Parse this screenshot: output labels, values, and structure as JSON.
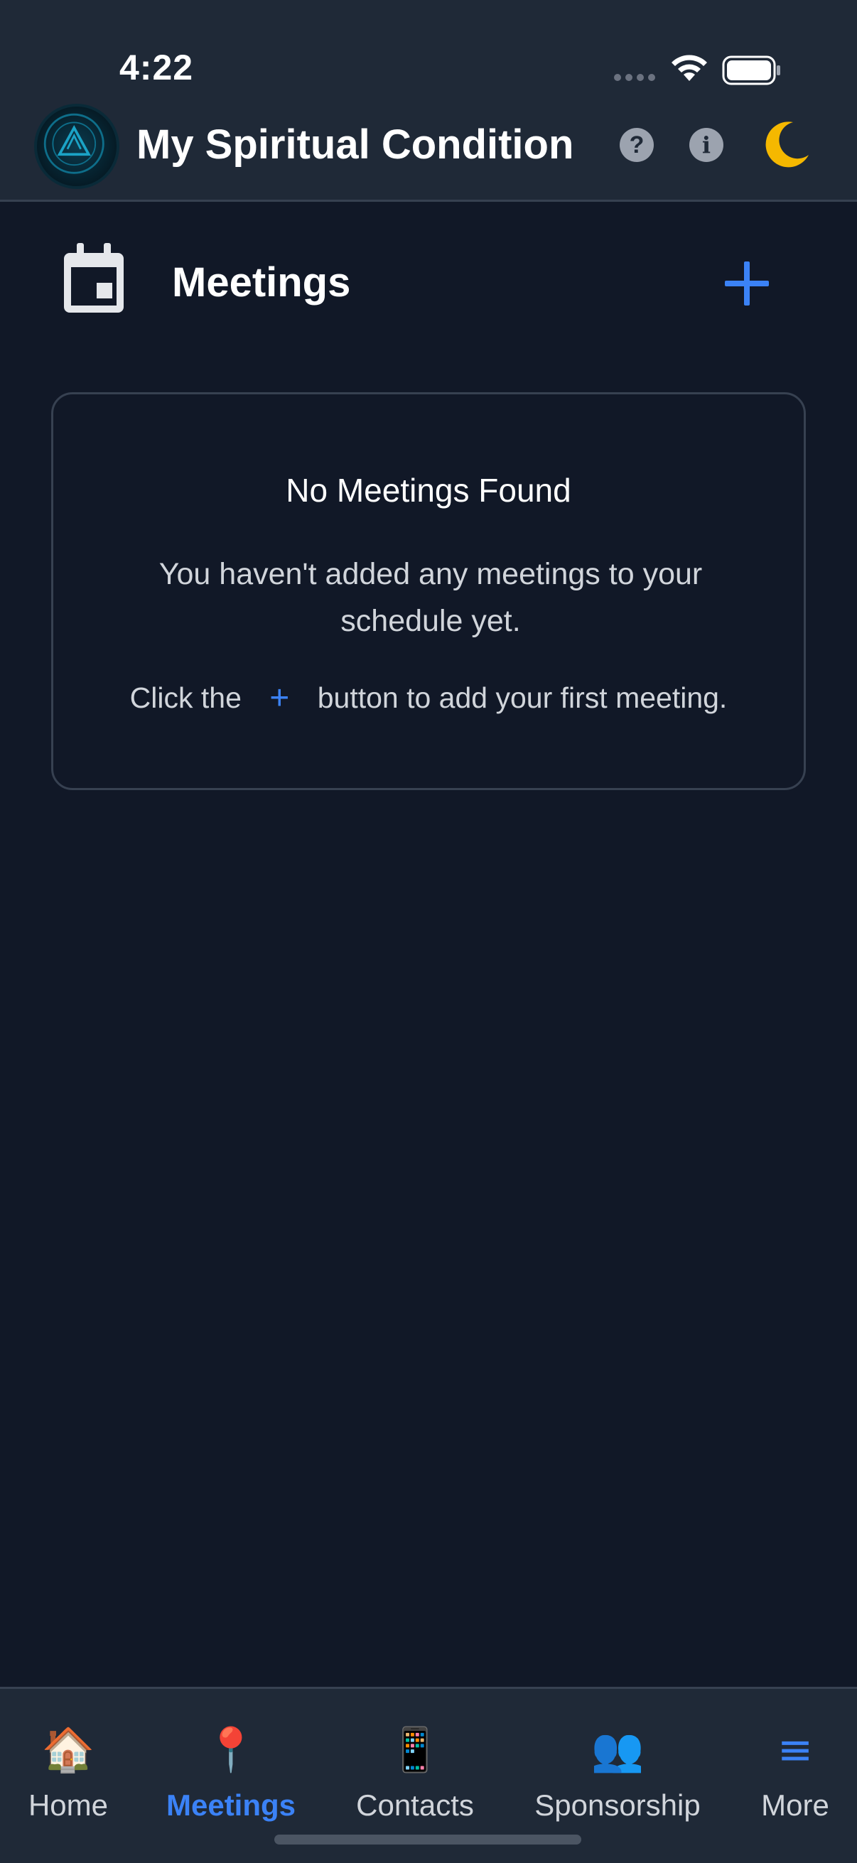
{
  "status_bar": {
    "time": "4:22"
  },
  "header": {
    "title": "My Spiritual Condition",
    "logo_name": "spiritual-condition-tracker-logo",
    "help_label": "?",
    "info_label": "i"
  },
  "section": {
    "title": "Meetings",
    "add_label": "+"
  },
  "empty_state": {
    "title": "No Meetings Found",
    "description": "You haven't added any meetings to your schedule yet.",
    "hint_before": "Click the",
    "hint_plus": "+",
    "hint_after": "button to add your first meeting."
  },
  "bottom_nav": {
    "items": [
      {
        "label": "Home",
        "icon": "🏠"
      },
      {
        "label": "Meetings",
        "icon": "📍",
        "active": true
      },
      {
        "label": "Contacts",
        "icon": "📱"
      },
      {
        "label": "Sponsorship",
        "icon": "👥"
      },
      {
        "label": "More",
        "icon": "≡"
      }
    ]
  },
  "colors": {
    "accent": "#3b82f6",
    "background": "#111827",
    "header": "#1f2937"
  }
}
